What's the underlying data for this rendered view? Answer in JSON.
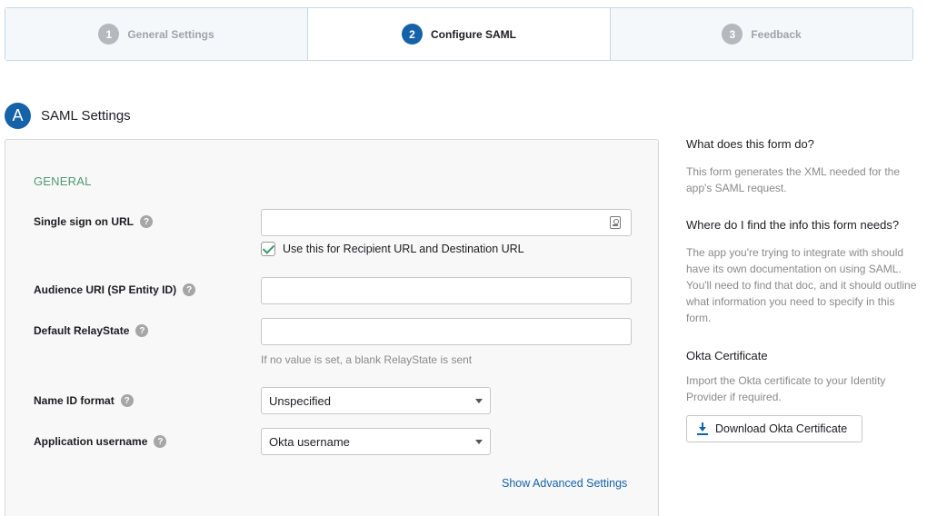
{
  "steps": [
    {
      "num": "1",
      "label": "General Settings"
    },
    {
      "num": "2",
      "label": "Configure SAML"
    },
    {
      "num": "3",
      "label": "Feedback"
    }
  ],
  "section": {
    "badge": "A",
    "title": "SAML Settings"
  },
  "form": {
    "group_title": "GENERAL",
    "help_glyph": "?",
    "sso_url": {
      "label": "Single sign on URL",
      "value": ""
    },
    "recipient_checkbox": {
      "label": "Use this for Recipient URL and Destination URL",
      "checked": true
    },
    "audience_uri": {
      "label": "Audience URI (SP Entity ID)",
      "value": ""
    },
    "relay_state": {
      "label": "Default RelayState",
      "value": "",
      "hint": "If no value is set, a blank RelayState is sent"
    },
    "name_id_format": {
      "label": "Name ID format",
      "selected": "Unspecified"
    },
    "app_username": {
      "label": "Application username",
      "selected": "Okta username"
    },
    "advanced_link": "Show Advanced Settings"
  },
  "sidebar": {
    "q1": {
      "title": "What does this form do?",
      "body": "This form generates the XML needed for the app's SAML request."
    },
    "q2": {
      "title": "Where do I find the info this form needs?",
      "body": "The app you're trying to integrate with should have its own documentation on using SAML. You'll need to find that doc, and it should outline what information you need to specify in this form."
    },
    "cert": {
      "title": "Okta Certificate",
      "body": "Import the Okta certificate to your Identity Provider if required.",
      "button": "Download Okta Certificate"
    }
  },
  "colors": {
    "accent": "#1662a8",
    "group_title": "#4f9a73",
    "muted": "#8a8a8a"
  }
}
